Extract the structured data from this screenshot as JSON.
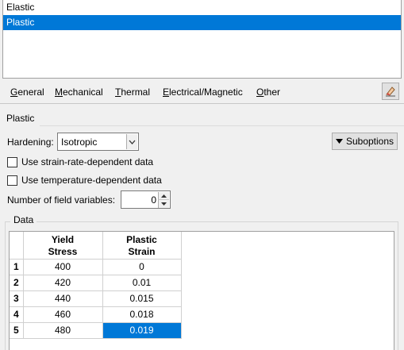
{
  "behaviors": [
    "Elastic",
    "Plastic"
  ],
  "selected_behavior": "Plastic",
  "menu": [
    {
      "prefix": "",
      "u": "G",
      "rest": "eneral"
    },
    {
      "prefix": "",
      "u": "M",
      "rest": "echanical"
    },
    {
      "prefix": "",
      "u": "T",
      "rest": "hermal"
    },
    {
      "prefix": "",
      "u": "E",
      "rest": "lectrical/Magnetic"
    },
    {
      "prefix": "",
      "u": "O",
      "rest": "ther"
    }
  ],
  "section_title": "Plastic",
  "hardening": {
    "label": "Hardening:",
    "value": "Isotropic"
  },
  "suboptions_label": "Suboptions",
  "checkboxes": [
    {
      "label": "Use strain-rate-dependent data",
      "checked": false
    },
    {
      "label": "Use temperature-dependent data",
      "checked": false
    }
  ],
  "field_variables": {
    "label": "Number of field variables:",
    "value": "0"
  },
  "data_group_label": "Data",
  "table": {
    "headers": [
      [
        "Yield",
        "Stress"
      ],
      [
        "Plastic",
        "Strain"
      ]
    ],
    "rows": [
      {
        "num": "1",
        "yield": "400",
        "strain": "0"
      },
      {
        "num": "2",
        "yield": "420",
        "strain": "0.01"
      },
      {
        "num": "3",
        "yield": "440",
        "strain": "0.015"
      },
      {
        "num": "4",
        "yield": "460",
        "strain": "0.018"
      },
      {
        "num": "5",
        "yield": "480",
        "strain": "0.019"
      }
    ],
    "selected_cell": {
      "row": 4,
      "col": "strain"
    }
  },
  "colors": {
    "selection": "#0078d7",
    "background": "#f0f0f0"
  },
  "icons": [
    "edit-eraser-icon",
    "dropdown-arrow-icon",
    "spin-up-icon",
    "spin-down-icon",
    "triangle-down-icon"
  ]
}
